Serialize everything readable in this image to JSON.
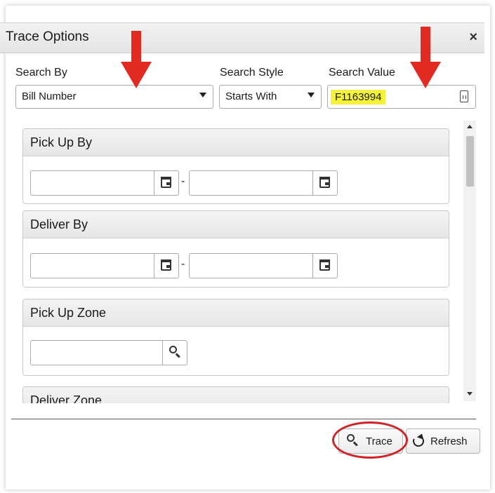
{
  "dialog": {
    "title": "Trace Options",
    "close_glyph": "×"
  },
  "search": {
    "by_label": "Search By",
    "by_value": "Bill Number",
    "style_label": "Search Style",
    "style_value": "Starts With",
    "value_label": "Search Value",
    "value_text": "F1163994",
    "value_highlight": "#f4f23a"
  },
  "groups": {
    "pickup_by": {
      "title": "Pick Up By",
      "separator": "-"
    },
    "deliver_by": {
      "title": "Deliver By",
      "separator": "-"
    },
    "pickup_zone": {
      "title": "Pick Up Zone"
    },
    "deliver_zone": {
      "title": "Deliver Zone"
    }
  },
  "buttons": {
    "trace": "Trace",
    "refresh": "Refresh"
  },
  "annotations": {
    "arrow_color": "#e02a22",
    "circle_color": "#d32226"
  },
  "icons": [
    "close-icon",
    "dropdown-arrow-icon",
    "calculator-icon",
    "calendar-icon",
    "search-icon",
    "refresh-icon",
    "scroll-up-icon",
    "scroll-down-icon"
  ]
}
